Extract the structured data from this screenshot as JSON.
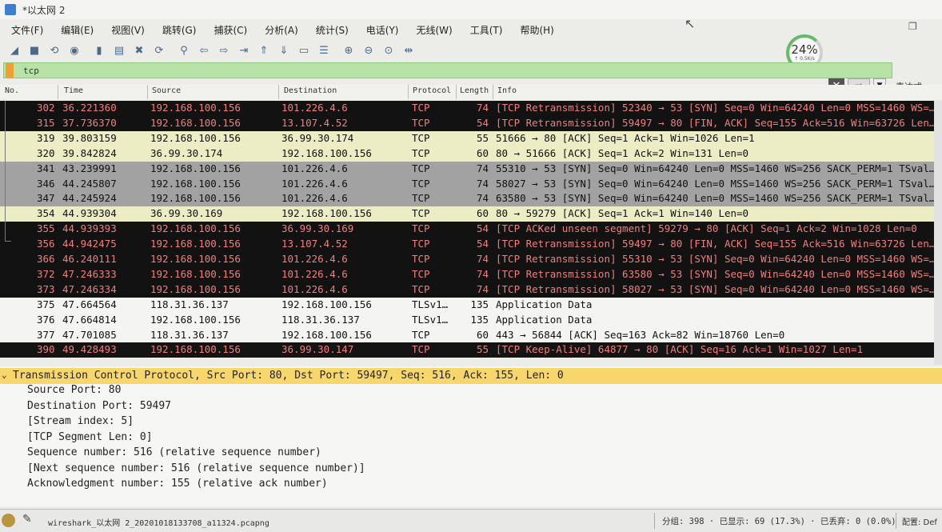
{
  "window": {
    "title": "*以太网 2",
    "controls": {
      "restore": "❐"
    }
  },
  "menu": [
    "文件(F)",
    "编辑(E)",
    "视图(V)",
    "跳转(G)",
    "捕获(C)",
    "分析(A)",
    "统计(S)",
    "电话(Y)",
    "无线(W)",
    "工具(T)",
    "帮助(H)"
  ],
  "toolbar": {
    "icons": [
      "shark-fin-icon",
      "stop-icon",
      "restart-icon",
      "options-icon",
      "open-icon",
      "file-icon",
      "close-file-icon",
      "reload-icon",
      "find-icon",
      "back-icon",
      "forward-icon",
      "go-to-icon",
      "first-icon",
      "last-icon",
      "autoscroll-icon",
      "colorize-icon",
      "zoom-in-icon",
      "zoom-out-icon",
      "zoom-reset-icon",
      "resize-columns-icon"
    ],
    "glyphs": [
      "◢",
      "■",
      "⟲",
      "◉",
      "▮",
      "▤",
      "✖",
      "⟳",
      "⚲",
      "⇦",
      "⇨",
      "⇥",
      "⇑",
      "⇓",
      "▭",
      "☰",
      "⊕",
      "⊖",
      "⊙",
      "⇹"
    ]
  },
  "gauge": {
    "percent": "24%",
    "rate": "↑ 0.5K/s"
  },
  "filter": {
    "value": "tcp",
    "expression_label": "表达式…",
    "clear_label": "✕",
    "apply_label": "➡",
    "dropdown_label": "▼"
  },
  "columns": [
    "No.",
    "Time",
    "Source",
    "Destination",
    "Protocol",
    "Length",
    "Info"
  ],
  "packets": [
    {
      "no": "302",
      "time": "36.221360",
      "src": "192.168.100.156",
      "dst": "101.226.4.6",
      "proto": "TCP",
      "len": "74",
      "info": "[TCP Retransmission] 52340 → 53 [SYN] Seq=0 Win=64240 Len=0 MSS=1460 WS=…",
      "style": "bad"
    },
    {
      "no": "315",
      "time": "37.736370",
      "src": "192.168.100.156",
      "dst": "13.107.4.52",
      "proto": "TCP",
      "len": "54",
      "info": "[TCP Retransmission] 59497 → 80 [FIN, ACK] Seq=155 Ack=516 Win=63726 Len…",
      "style": "bad"
    },
    {
      "no": "319",
      "time": "39.803159",
      "src": "192.168.100.156",
      "dst": "36.99.30.174",
      "proto": "TCP",
      "len": "55",
      "info": "51666 → 80 [ACK] Seq=1 Ack=1 Win=1026 Len=1",
      "style": "yellow"
    },
    {
      "no": "320",
      "time": "39.842824",
      "src": "36.99.30.174",
      "dst": "192.168.100.156",
      "proto": "TCP",
      "len": "60",
      "info": "80 → 51666 [ACK] Seq=1 Ack=2 Win=131 Len=0",
      "style": "yellow"
    },
    {
      "no": "341",
      "time": "43.239991",
      "src": "192.168.100.156",
      "dst": "101.226.4.6",
      "proto": "TCP",
      "len": "74",
      "info": "55310 → 53 [SYN] Seq=0 Win=64240 Len=0 MSS=1460 WS=256 SACK_PERM=1 TSval…",
      "style": "gray"
    },
    {
      "no": "346",
      "time": "44.245807",
      "src": "192.168.100.156",
      "dst": "101.226.4.6",
      "proto": "TCP",
      "len": "74",
      "info": "58027 → 53 [SYN] Seq=0 Win=64240 Len=0 MSS=1460 WS=256 SACK_PERM=1 TSval…",
      "style": "gray"
    },
    {
      "no": "347",
      "time": "44.245924",
      "src": "192.168.100.156",
      "dst": "101.226.4.6",
      "proto": "TCP",
      "len": "74",
      "info": "63580 → 53 [SYN] Seq=0 Win=64240 Len=0 MSS=1460 WS=256 SACK_PERM=1 TSval…",
      "style": "gray"
    },
    {
      "no": "354",
      "time": "44.939304",
      "src": "36.99.30.169",
      "dst": "192.168.100.156",
      "proto": "TCP",
      "len": "60",
      "info": "80 → 59279 [ACK] Seq=1 Ack=1 Win=140 Len=0",
      "style": "yellow"
    },
    {
      "no": "355",
      "time": "44.939393",
      "src": "192.168.100.156",
      "dst": "36.99.30.169",
      "proto": "TCP",
      "len": "54",
      "info": "[TCP ACKed unseen segment] 59279 → 80 [ACK] Seq=1 Ack=2 Win=1028 Len=0",
      "style": "bad"
    },
    {
      "no": "356",
      "time": "44.942475",
      "src": "192.168.100.156",
      "dst": "13.107.4.52",
      "proto": "TCP",
      "len": "54",
      "info": "[TCP Retransmission] 59497 → 80 [FIN, ACK] Seq=155 Ack=516 Win=63726 Len…",
      "style": "bad"
    },
    {
      "no": "366",
      "time": "46.240111",
      "src": "192.168.100.156",
      "dst": "101.226.4.6",
      "proto": "TCP",
      "len": "74",
      "info": "[TCP Retransmission] 55310 → 53 [SYN] Seq=0 Win=64240 Len=0 MSS=1460 WS=…",
      "style": "bad"
    },
    {
      "no": "372",
      "time": "47.246333",
      "src": "192.168.100.156",
      "dst": "101.226.4.6",
      "proto": "TCP",
      "len": "74",
      "info": "[TCP Retransmission] 63580 → 53 [SYN] Seq=0 Win=64240 Len=0 MSS=1460 WS=…",
      "style": "bad"
    },
    {
      "no": "373",
      "time": "47.246334",
      "src": "192.168.100.156",
      "dst": "101.226.4.6",
      "proto": "TCP",
      "len": "74",
      "info": "[TCP Retransmission] 58027 → 53 [SYN] Seq=0 Win=64240 Len=0 MSS=1460 WS=…",
      "style": "bad"
    },
    {
      "no": "375",
      "time": "47.664564",
      "src": "118.31.36.137",
      "dst": "192.168.100.156",
      "proto": "TLSv1…",
      "len": "135",
      "info": "Application Data",
      "style": "white"
    },
    {
      "no": "376",
      "time": "47.664814",
      "src": "192.168.100.156",
      "dst": "118.31.36.137",
      "proto": "TLSv1…",
      "len": "135",
      "info": "Application Data",
      "style": "white"
    },
    {
      "no": "377",
      "time": "47.701085",
      "src": "118.31.36.137",
      "dst": "192.168.100.156",
      "proto": "TCP",
      "len": "60",
      "info": "443 → 56844 [ACK] Seq=163 Ack=82 Win=18760 Len=0",
      "style": "white"
    },
    {
      "no": "390",
      "time": "49.428493",
      "src": "192.168.100.156",
      "dst": "36.99.30.147",
      "proto": "TCP",
      "len": "55",
      "info": "[TCP Keep-Alive] 64877 → 80 [ACK] Seq=16 Ack=1 Win=1027 Len=1",
      "style": "sel-black"
    }
  ],
  "detail": {
    "expander": "⌄",
    "header": "Transmission Control Protocol, Src Port: 80, Dst Port: 59497, Seq: 516, Ack: 155, Len: 0",
    "lines": [
      "Source Port: 80",
      "Destination Port: 59497",
      "[Stream index: 5]",
      "[TCP Segment Len: 0]",
      "Sequence number: 516    (relative sequence number)",
      "[Next sequence number: 516    (relative sequence number)]",
      "Acknowledgment number: 155    (relative ack number)"
    ]
  },
  "status": {
    "edit_glyph": "✎",
    "file": "wireshark_以太网 2_20201018133708_a11324.pcapng",
    "stats": "分组: 398 · 已显示: 69 (17.3%) · 已丢弃: 0 (0.0%)",
    "profile": "配置: Def"
  }
}
